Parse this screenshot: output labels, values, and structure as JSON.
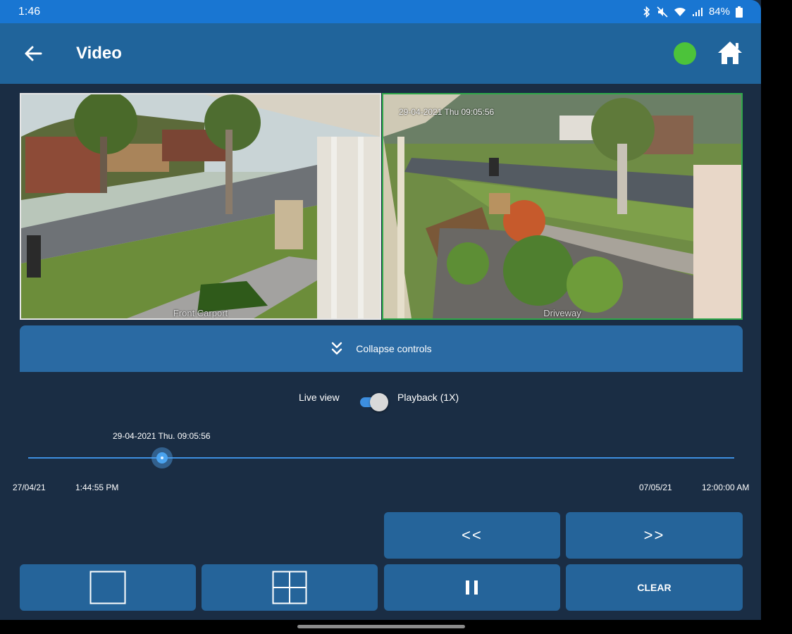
{
  "status_bar": {
    "time": "1:46",
    "battery": "84%"
  },
  "appbar": {
    "title": "Video"
  },
  "cameras": [
    {
      "label": "Front Carport",
      "osd": ""
    },
    {
      "label": "Driveway",
      "osd": "29-04-2021 Thu 09:05:56"
    }
  ],
  "controls": {
    "collapse_label": "Collapse controls",
    "live_view_label": "Live view",
    "playback_label": "Playback (1X)",
    "playback_enabled": true,
    "current_timestamp": "29-04-2021 Thu. 09:05:56",
    "slider_position": 0.19,
    "range_start_date": "27/04/21",
    "range_start_time": "1:44:55 PM",
    "range_end_date": "07/05/21",
    "range_end_time": "12:00:00 AM"
  },
  "buttons": {
    "rewind": "<<",
    "fast_forward": ">>",
    "clear": "CLEAR"
  },
  "colors": {
    "accent": "#1976d2",
    "appbar": "#20649b",
    "background": "#1a2d44",
    "online": "#4cc33a"
  }
}
